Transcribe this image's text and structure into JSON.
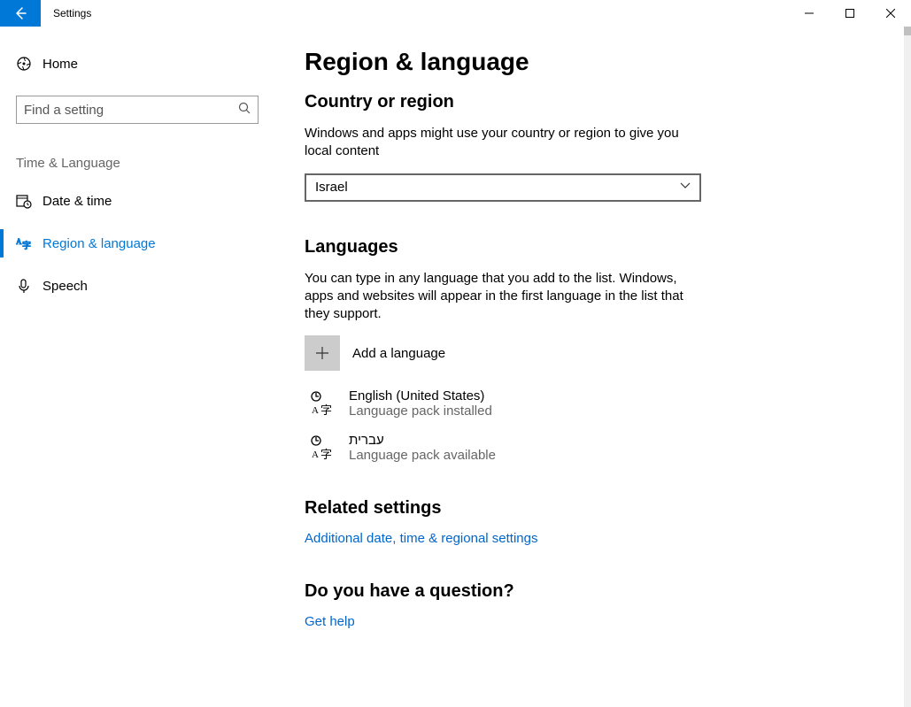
{
  "window": {
    "title": "Settings"
  },
  "sidebar": {
    "home": "Home",
    "search_placeholder": "Find a setting",
    "group": "Time & Language",
    "items": [
      {
        "label": "Date & time"
      },
      {
        "label": "Region & language"
      },
      {
        "label": "Speech"
      }
    ]
  },
  "page": {
    "title": "Region & language",
    "region_section": "Country or region",
    "region_desc": "Windows and apps might use your country or region to give you local content",
    "region_value": "Israel",
    "languages_section": "Languages",
    "languages_desc": "You can type in any language that you add to the list. Windows, apps and websites will appear in the first language in the list that they support.",
    "add_language": "Add a language",
    "langs": [
      {
        "name": "English (United States)",
        "status": "Language pack installed"
      },
      {
        "name": "עברית",
        "status": "Language pack available"
      }
    ],
    "related_section": "Related settings",
    "related_link": "Additional date, time & regional settings",
    "question_section": "Do you have a question?",
    "help_link": "Get help"
  }
}
